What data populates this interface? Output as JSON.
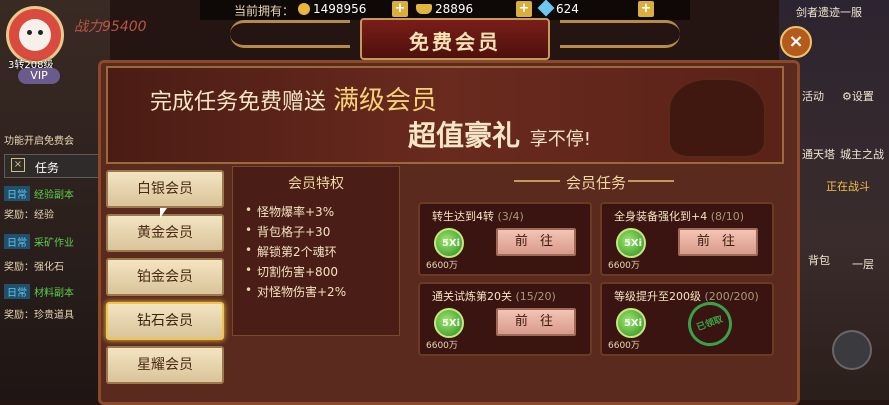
{
  "hud": {
    "power": "战力95400",
    "level": "3转208级",
    "vip": "VIP",
    "function_notice": "功能开启免费会",
    "task_tab": "任务",
    "tasks": [
      {
        "tag": "日常",
        "name": "经验副本",
        "reward": "奖励：经验"
      },
      {
        "tag": "日常",
        "name": "采矿作业",
        "reward": "奖励：强化石"
      },
      {
        "tag": "日常",
        "name": "材料副本",
        "reward": "奖励：珍贵道具"
      }
    ],
    "right": {
      "server": "剑者遗迹一服",
      "activity": "活动",
      "settings": "设置",
      "tower": "通天塔",
      "city": "城主之战",
      "fighting": "正在战斗",
      "bag": "背包",
      "layer": "一层"
    }
  },
  "resources": {
    "label": "当前拥有：",
    "coins": "1498956",
    "ingots": "28896",
    "diamonds": "624"
  },
  "modal": {
    "title": "免费会员",
    "close": "×",
    "banner_line1_a": "完成任务免费赠送",
    "banner_line1_b": "满级会员",
    "banner_line2_a": "超值豪礼",
    "banner_line2_b": "享不停!",
    "tabs": [
      "白银会员",
      "黄金会员",
      "铂金会员",
      "钻石会员",
      "星耀会员"
    ],
    "privilege_title": "会员特权",
    "privileges": [
      "怪物爆率+3%",
      "背包格子+30",
      "解锁第2个魂环",
      "切割伤害+800",
      "对怪物伤害+2%"
    ],
    "task_title": "会员任务",
    "tasks": [
      {
        "name": "转生达到4转",
        "progress": "(3/4)",
        "reward_icon": "5Xi",
        "reward": "6600万",
        "button": "前 往"
      },
      {
        "name": "全身装备强化到+4",
        "progress": "(8/10)",
        "reward_icon": "5Xi",
        "reward": "6600万",
        "button": "前 往"
      },
      {
        "name": "通关试炼第20关",
        "progress": "(15/20)",
        "reward_icon": "5Xi",
        "reward": "6600万",
        "button": "前 往"
      },
      {
        "name": "等级提升至200级",
        "progress": "(200/200)",
        "reward_icon": "5Xi",
        "reward": "6600万",
        "stamp": "已领取"
      }
    ]
  }
}
